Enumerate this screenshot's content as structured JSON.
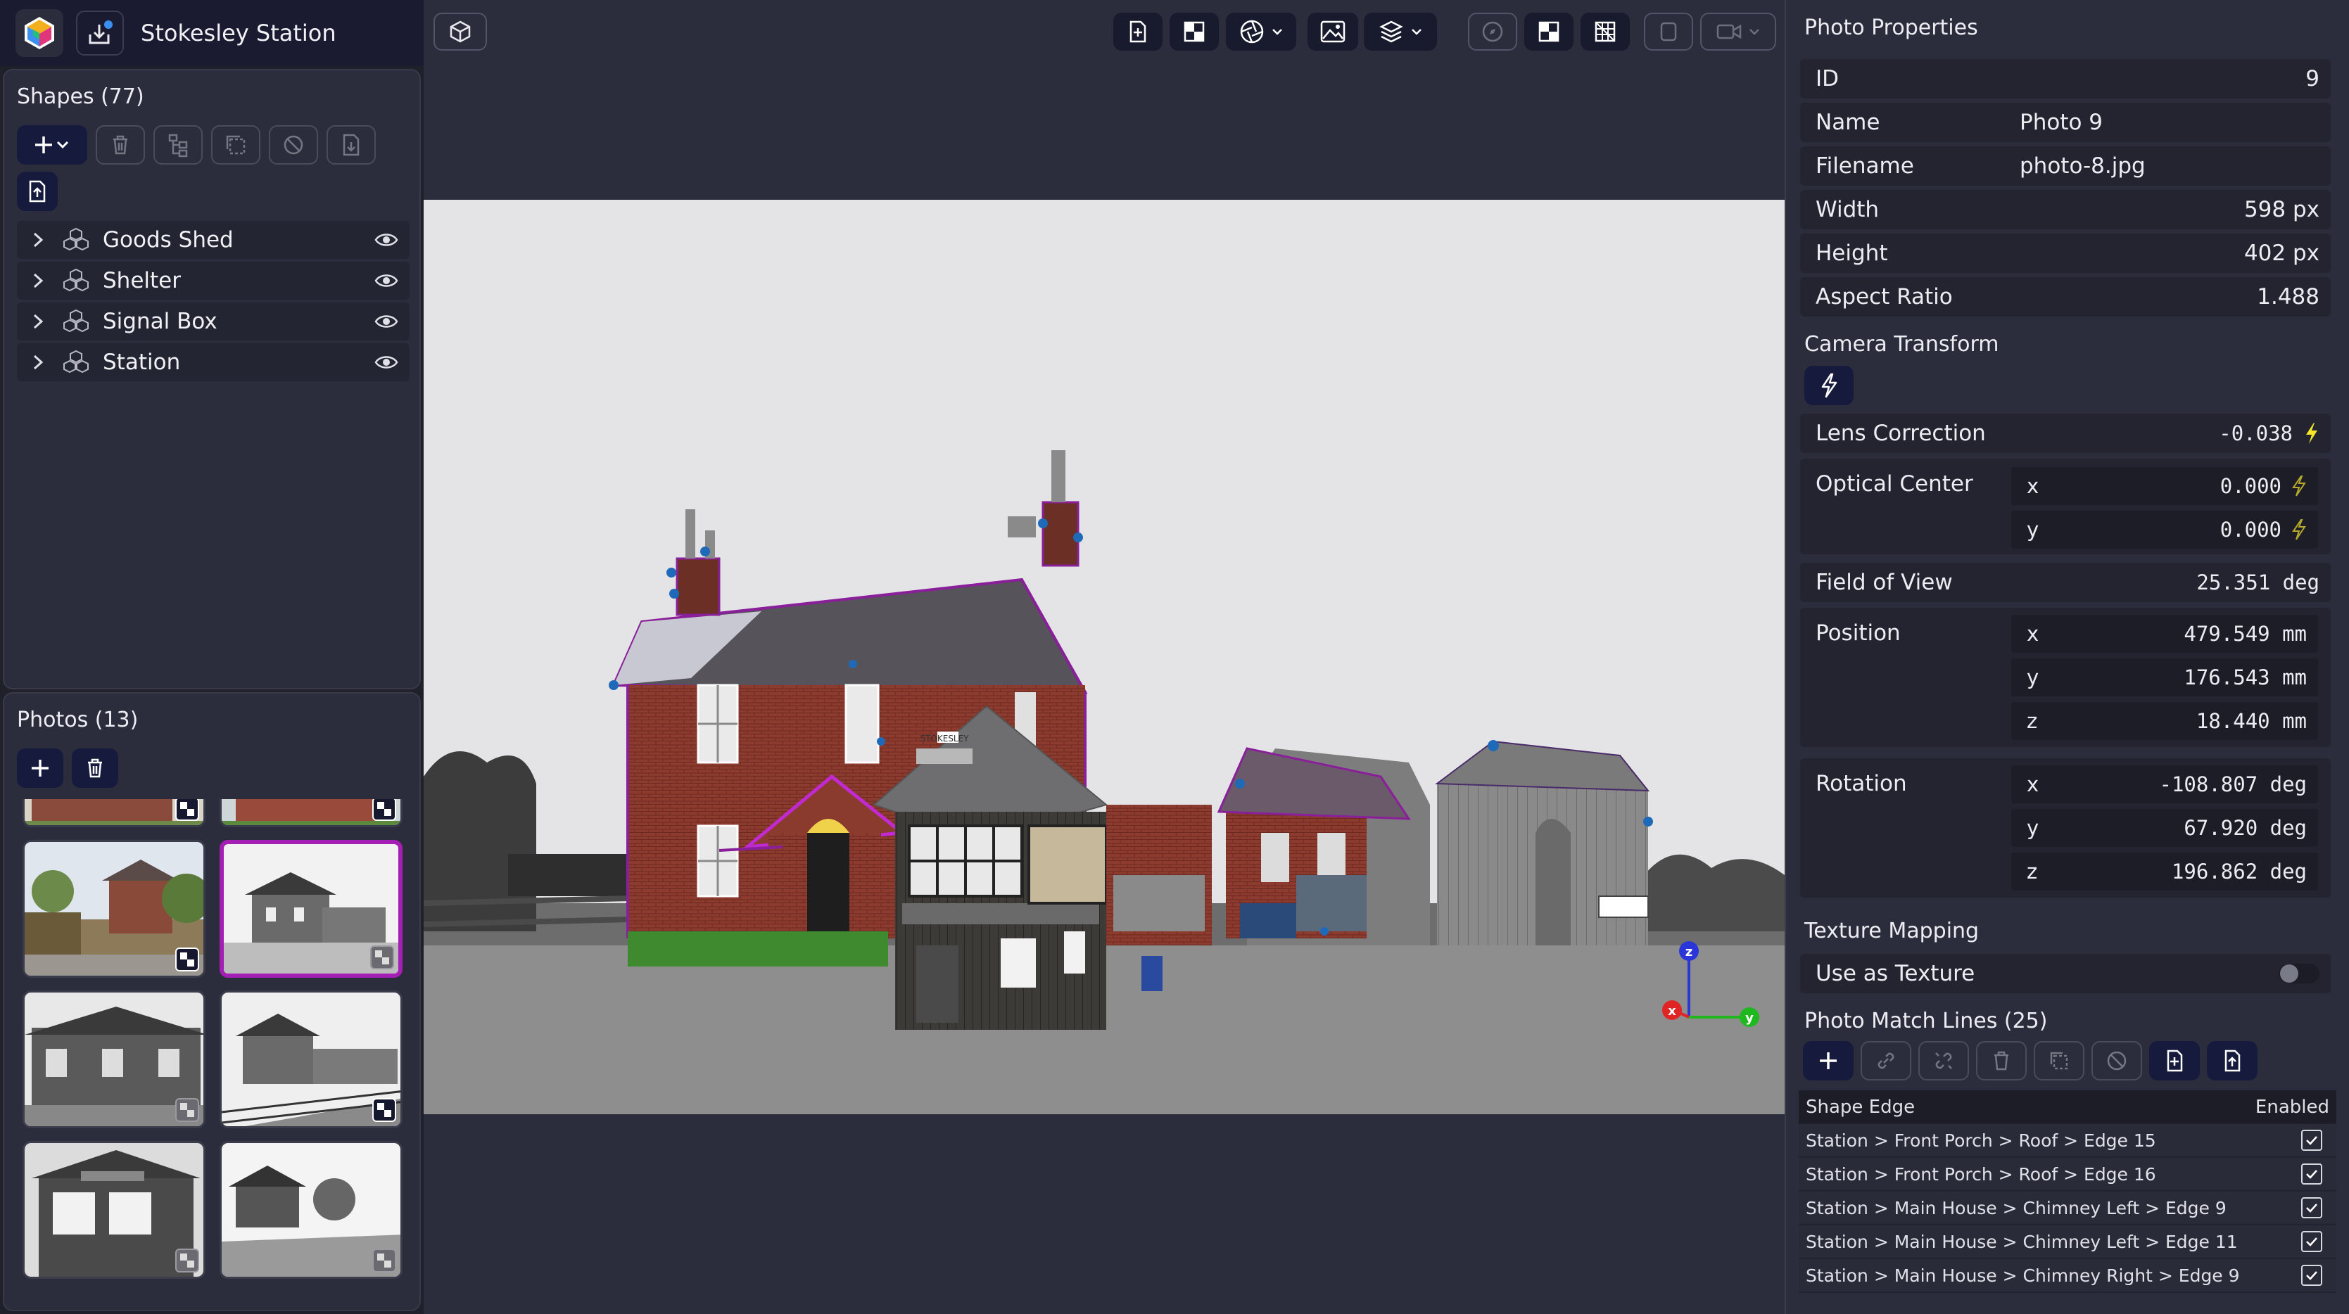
{
  "app": {
    "project_title": "Stokesley Station"
  },
  "shapes": {
    "title": "Shapes (77)",
    "items": [
      {
        "label": "Goods Shed"
      },
      {
        "label": "Shelter"
      },
      {
        "label": "Signal Box"
      },
      {
        "label": "Station"
      }
    ]
  },
  "photos": {
    "title": "Photos (13)"
  },
  "properties": {
    "title": "Photo Properties",
    "id_label": "ID",
    "id_value": "9",
    "name_label": "Name",
    "name_value": "Photo 9",
    "filename_label": "Filename",
    "filename_value": "photo-8.jpg",
    "width_label": "Width",
    "width_value": "598 px",
    "height_label": "Height",
    "height_value": "402 px",
    "aspect_label": "Aspect Ratio",
    "aspect_value": "1.488"
  },
  "camera": {
    "title": "Camera Transform",
    "lens_label": "Lens Correction",
    "lens_value": "-0.038",
    "optical_label": "Optical Center",
    "optical_x": "0.000",
    "optical_y": "0.000",
    "fov_label": "Field of View",
    "fov_value": "25.351 deg",
    "position_label": "Position",
    "pos_x": "479.549 mm",
    "pos_y": "176.543 mm",
    "pos_z": "18.440 mm",
    "rotation_label": "Rotation",
    "rot_x": "-108.807 deg",
    "rot_y": "67.920 deg",
    "rot_z": "196.862 deg",
    "axis_x": "x",
    "axis_y": "y",
    "axis_z": "z"
  },
  "texture": {
    "title": "Texture Mapping",
    "use_label": "Use as Texture",
    "use_enabled": false
  },
  "match_lines": {
    "title": "Photo Match Lines (25)",
    "col_edge": "Shape Edge",
    "col_enabled": "Enabled",
    "rows": [
      {
        "edge": "Station > Front Porch > Roof > Edge 15",
        "enabled": true
      },
      {
        "edge": "Station > Front Porch > Roof > Edge 16",
        "enabled": true
      },
      {
        "edge": "Station > Main House > Chimney Left > Edge 9",
        "enabled": true
      },
      {
        "edge": "Station > Main House > Chimney Left > Edge 11",
        "enabled": true
      },
      {
        "edge": "Station > Main House > Chimney Right > Edge 9",
        "enabled": true
      }
    ]
  },
  "viewport": {
    "gizmo_x": "x",
    "gizmo_y": "y",
    "gizmo_z": "z",
    "sign_text": "STOKESLEY"
  },
  "colors": {
    "accent_purple": "#a41fb3",
    "primary_button": "#161a3d",
    "lightning_yellow": "#f5e62a",
    "gizmo_x": "#e02525",
    "gizmo_y": "#1fb81f",
    "gizmo_z": "#2a36d8"
  },
  "icons": [
    "app-logo-icon",
    "import-icon",
    "plus-icon",
    "chevron-down-icon",
    "trash-icon",
    "hierarchy-icon",
    "duplicate-icon",
    "disable-icon",
    "export-icon",
    "import-file-icon",
    "chevron-right-icon",
    "shapes-group-icon",
    "eye-icon",
    "cube-icon",
    "checker-icon",
    "aperture-icon",
    "image-icon",
    "layers-icon",
    "compass-icon",
    "grid-icon",
    "frame-icon",
    "video-icon",
    "lightning-icon",
    "link-icon",
    "unlink-icon",
    "checkbox-checked-icon"
  ]
}
